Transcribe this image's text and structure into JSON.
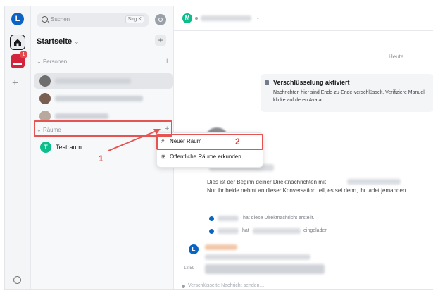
{
  "rail": {
    "avatar_letter": "L",
    "home_icon": "home-icon",
    "space_badge": "1",
    "add_label": "+"
  },
  "sidebar": {
    "search_placeholder": "Suchen",
    "search_shortcut": "Strg K",
    "home_title": "Startseite",
    "home_add": "+",
    "people_section": "Personen",
    "people_add": "+",
    "rooms_section": "Räume",
    "rooms_add": "+",
    "rooms": [
      {
        "letter": "T",
        "name": "Testraum"
      }
    ]
  },
  "menu": {
    "new_room": "Neuer Raum",
    "explore_rooms": "Öffentliche Räume erkunden"
  },
  "annotations": {
    "label_1": "1",
    "label_2": "2"
  },
  "header": {
    "avatar_letter": "M"
  },
  "timeline": {
    "date_separator": "Heute",
    "encryption_title": "Verschlüsselung aktiviert",
    "encryption_text": "Nachrichten hier sind Ende-zu-Ende-verschlüsselt. Verifiziere Manuel klicke auf deren Avatar.",
    "begin_line1": "Dies ist der Beginn deiner Direktnachrichten mit",
    "begin_line2": "Nur ihr beide nehmt an dieser Konversation teil, es sei denn, ihr ladet jemanden",
    "event_created": "hat diese Direktnachricht erstellt.",
    "event_invited_prefix": "hat",
    "event_invited_suffix": "eingeladen",
    "message_avatar_letter": "L",
    "message_time": "12:59"
  },
  "composer": {
    "placeholder": "Verschlüsselte Nachricht senden…"
  },
  "colors": {
    "accent": "#0dbd8b",
    "annotation": "#e55353",
    "link": "#0b64c4"
  }
}
